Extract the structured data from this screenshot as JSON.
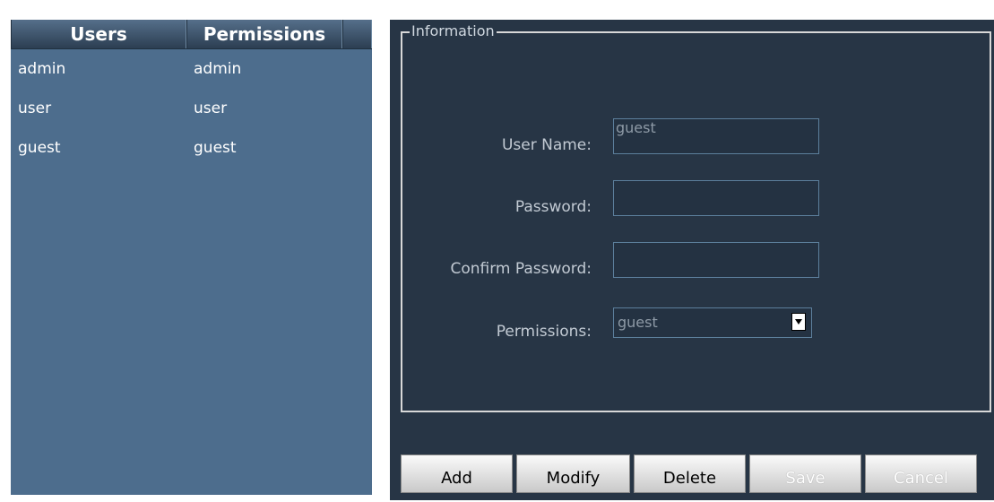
{
  "user_list": {
    "headers": {
      "users": "Users",
      "permissions": "Permissions"
    },
    "rows": [
      {
        "name": "admin",
        "permission": "admin"
      },
      {
        "name": "user",
        "permission": "user"
      },
      {
        "name": "guest",
        "permission": "guest"
      }
    ]
  },
  "information": {
    "legend": "Information",
    "user_name": {
      "label": "User Name:",
      "value": "guest"
    },
    "password": {
      "label": "Password:",
      "value": ""
    },
    "confirm_password": {
      "label": "Confirm Password:",
      "value": ""
    },
    "permissions": {
      "label": "Permissions:",
      "selected": "guest"
    }
  },
  "actions": {
    "add": "Add",
    "modify": "Modify",
    "delete": "Delete",
    "save": "Save",
    "cancel": "Cancel"
  }
}
